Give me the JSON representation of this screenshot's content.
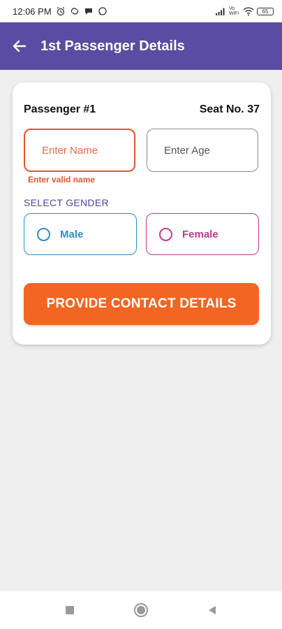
{
  "status_bar": {
    "time": "12:06 PM",
    "left_icons": [
      "alarm-icon",
      "sync-icon",
      "chat-icon",
      "whatsapp-icon"
    ],
    "right_icons": [
      "signal-icon",
      "volte-icon",
      "wifi-icon",
      "battery-icon"
    ],
    "volte_text": "Vo WiFi",
    "battery_text": "65"
  },
  "appbar": {
    "title": "1st Passenger Details",
    "background": "#5a4ba3"
  },
  "passenger": {
    "label": "Passenger #1",
    "seat": "Seat No. 37"
  },
  "form": {
    "name_placeholder": "Enter Name",
    "name_value": "",
    "name_error": "Enter valid name",
    "age_placeholder": "Enter Age",
    "age_value": "",
    "gender_label": "SELECT GENDER",
    "gender_options": [
      "Male",
      "Female"
    ],
    "selected_gender": null
  },
  "cta": {
    "label": "PROVIDE CONTACT DETAILS",
    "color": "#f26522"
  },
  "nav_bar": {
    "buttons": [
      "recents-icon",
      "home-icon",
      "back-icon"
    ]
  },
  "colors": {
    "error": "#e0582b",
    "male": "#2c8fc6",
    "female": "#c23a8b",
    "gender_label": "#4e47a0"
  }
}
